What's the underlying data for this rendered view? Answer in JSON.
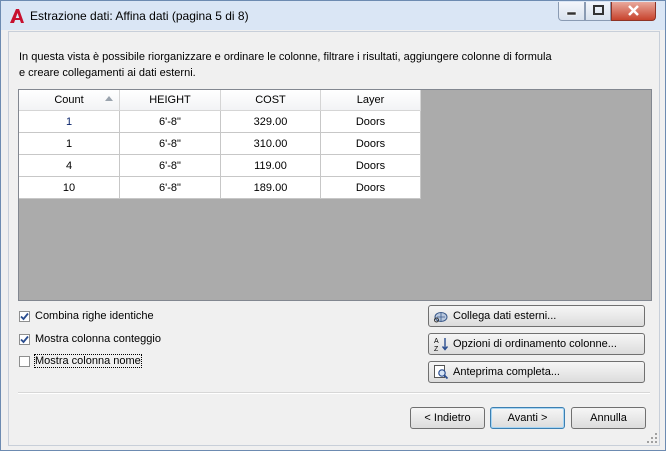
{
  "window": {
    "title": "Estrazione dati: Affina dati (pagina 5 di 8)"
  },
  "description": "In questa vista è possibile riorganizzare e ordinare le colonne, filtrare i risultati, aggiungere colonne di formula e creare collegamenti ai dati esterni.",
  "grid": {
    "columns": [
      "Count",
      "HEIGHT",
      "COST",
      "Layer"
    ],
    "rows": [
      [
        "1",
        "6'-8\"",
        "329.00",
        "Doors"
      ],
      [
        "1",
        "6'-8\"",
        "310.00",
        "Doors"
      ],
      [
        "4",
        "6'-8\"",
        "119.00",
        "Doors"
      ],
      [
        "10",
        "6'-8\"",
        "189.00",
        "Doors"
      ]
    ]
  },
  "options": [
    {
      "label": "Combina righe identiche",
      "checked": true
    },
    {
      "label": "Mostra colonna conteggio",
      "checked": true
    },
    {
      "label": "Mostra colonna nome",
      "checked": false
    }
  ],
  "side_buttons": {
    "link_external": "Collega dati esterni...",
    "sort_options": "Opzioni di ordinamento colonne...",
    "full_preview": "Anteprima completa..."
  },
  "footer": {
    "back": "< Indietro",
    "next": "Avanti >",
    "cancel": "Annulla"
  },
  "colors": {
    "titlebar": "#dae6f5",
    "grid_background": "#ababab",
    "close_button": "#c7432d",
    "app_icon": "#c8102e"
  }
}
